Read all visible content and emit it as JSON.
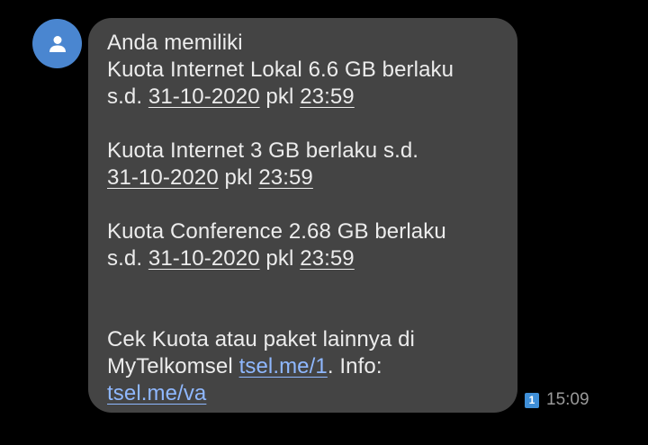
{
  "avatar": {
    "icon": "person-icon",
    "color": "#4a86d0"
  },
  "message": {
    "line1": "Anda memiliki",
    "line2": "Kuota Internet Lokal 6.6 GB berlaku",
    "line3_prefix": "s.d.",
    "date1": "31-10-2020",
    "pkl1": "pkl",
    "time1": "23:59",
    "line4": "Kuota Internet 3 GB berlaku s.d.",
    "date2": "31-10-2020",
    "pkl2": "pkl",
    "time2": "23:59",
    "line6": "Kuota Conference 2.68 GB berlaku",
    "line7_prefix": "s.d.",
    "date3": "31-10-2020",
    "pkl3": "pkl",
    "time3": "23:59",
    "line8": "Cek Kuota atau paket lainnya di",
    "line9_prefix": "MyTelkomsel",
    "link1": "tsel.me/1",
    "line9_suffix": ". Info:",
    "link2": "tsel.me/va"
  },
  "meta": {
    "sim_number": "1",
    "time": "15:09"
  },
  "colors": {
    "background": "#000000",
    "bubble": "#444444",
    "text": "#ececec",
    "link": "#8fb8ff",
    "sim_badge": "#3f8fd8"
  }
}
